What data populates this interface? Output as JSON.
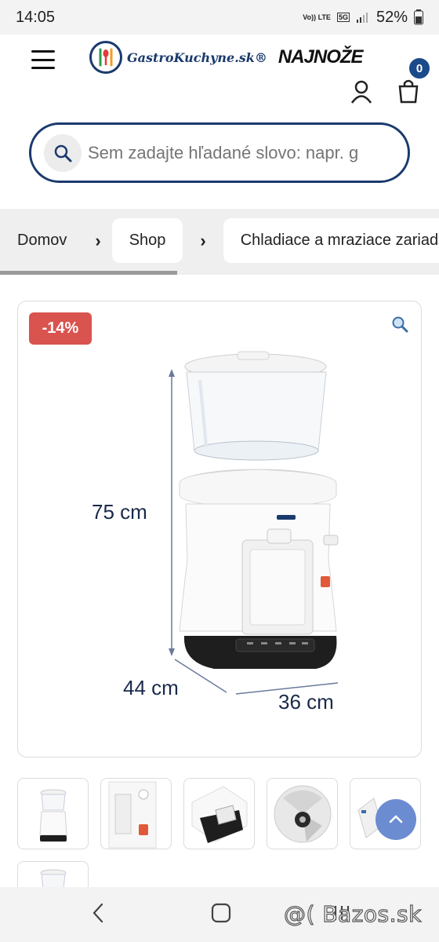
{
  "status_bar": {
    "time": "14:05",
    "volte": "Vo)) LTE",
    "network": "5G",
    "battery": "52%"
  },
  "header": {
    "logo_text": "GastroKuchyne.sk®",
    "logo_brand2": "NAJNOŽE",
    "cart_count": "0",
    "menu_icon": "hamburger-icon",
    "user_icon": "user-icon",
    "cart_icon": "shopping-bag-icon"
  },
  "search": {
    "placeholder": "Sem zadajte hľadané slovo: napr. g"
  },
  "breadcrumb": {
    "items": [
      "Domov",
      "Shop",
      "Chladiace a mraziace zariadenia"
    ]
  },
  "product": {
    "discount_badge": "-14%",
    "dimensions": {
      "height": "75 cm",
      "depth": "44 cm",
      "width": "36 cm"
    }
  },
  "watermark": "@( Bazos.sk",
  "colors": {
    "brand_navy": "#1a3a6e",
    "badge_red": "#d9534f",
    "cart_badge": "#1a4a8a",
    "to_top": "#6c8cd1"
  }
}
